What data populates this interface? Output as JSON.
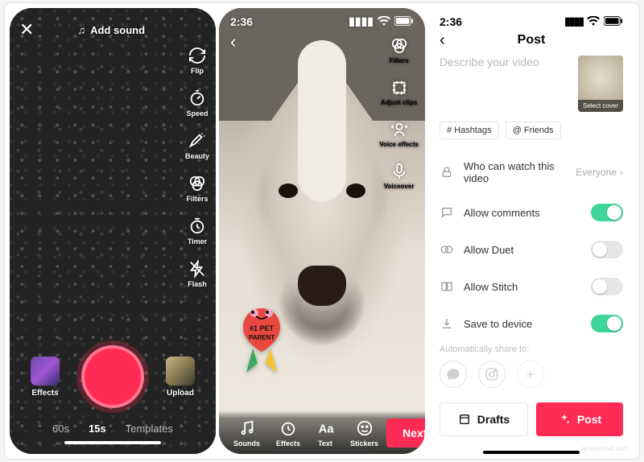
{
  "capture": {
    "add_sound": "Add sound",
    "tools": {
      "flip": "Flip",
      "speed": "Speed",
      "beauty": "Beauty",
      "filters": "Filters",
      "timer": "Timer",
      "flash": "Flash"
    },
    "effects": "Effects",
    "upload": "Upload",
    "modes": {
      "sixty": "60s",
      "fifteen": "15s",
      "templates": "Templates"
    }
  },
  "preview": {
    "time": "2:36",
    "tools": {
      "filters": "Filters",
      "adjust": "Adjust clips",
      "voice": "Voice effects",
      "voiceover": "Voiceover"
    },
    "bottom": {
      "sounds": "Sounds",
      "effects": "Effects",
      "text": "Text",
      "stickers": "Stickers"
    },
    "next": "Next",
    "sticker_text1": "#1 PET",
    "sticker_text2": "PARENT"
  },
  "post": {
    "time": "2:36",
    "title": "Post",
    "placeholder": "Describe your video",
    "cover": "Select cover",
    "chips": {
      "hashtags": "# Hashtags",
      "friends": "@ Friends"
    },
    "settings": {
      "who": {
        "label": "Who can watch this video",
        "value": "Everyone"
      },
      "comments": "Allow comments",
      "duet": "Allow Duet",
      "stitch": "Allow Stitch",
      "save": "Save to device"
    },
    "share_label": "Automatically share to:",
    "drafts": "Drafts",
    "post_btn": "Post"
  }
}
